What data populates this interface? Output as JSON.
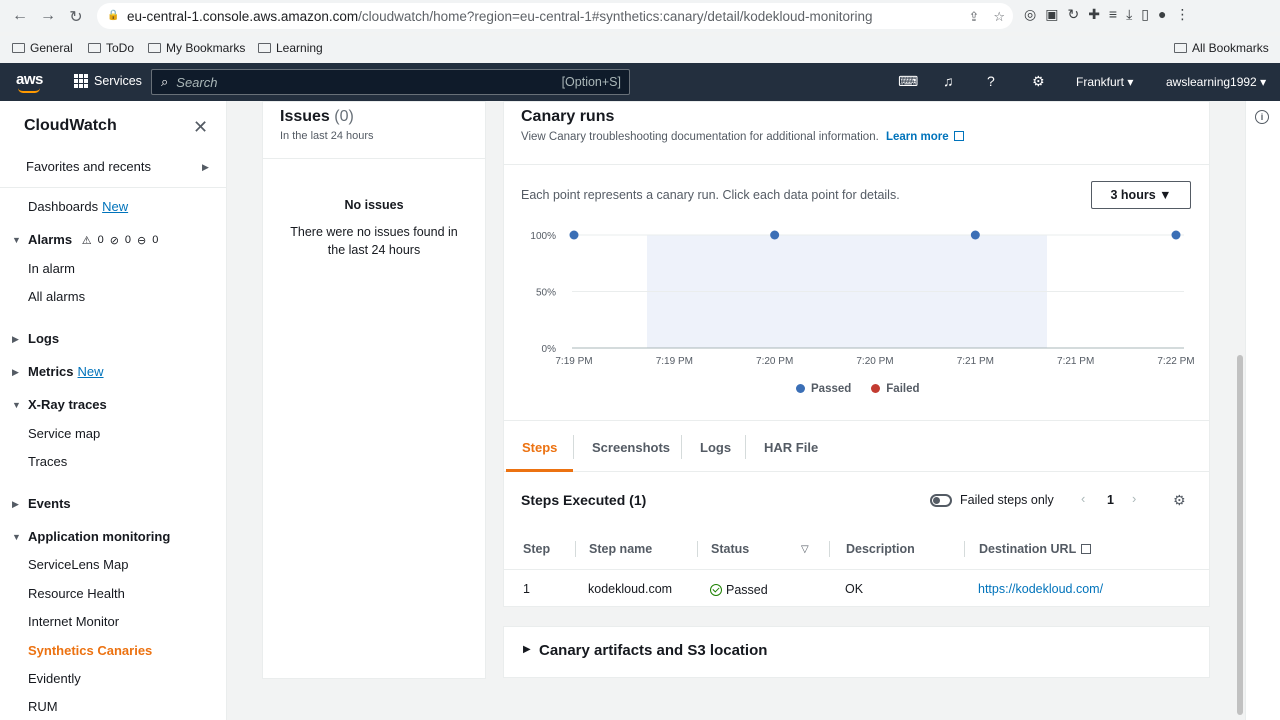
{
  "browser": {
    "url_host": "eu-central-1.console.aws.amazon.com",
    "url_path": "/cloudwatch/home?region=eu-central-1#synthetics:canary/detail/kodekloud-monitoring",
    "bookmarks": [
      "General",
      "ToDo",
      "My Bookmarks",
      "Learning"
    ],
    "all_bookmarks": "All Bookmarks"
  },
  "header": {
    "logo": "aws",
    "services": "Services",
    "search_placeholder": "Search",
    "search_shortcut": "[Option+S]",
    "region": "Frankfurt ▾",
    "account": "awslearning1992 ▾"
  },
  "sidebar": {
    "title": "CloudWatch",
    "favorites": "Favorites and recents",
    "dashboards": "Dashboards",
    "new_label": "New",
    "alarms": "Alarms",
    "alarm_counts": [
      "0",
      "0",
      "0"
    ],
    "in_alarm": "In alarm",
    "all_alarms": "All alarms",
    "logs": "Logs",
    "metrics": "Metrics",
    "xray": "X-Ray traces",
    "service_map": "Service map",
    "traces": "Traces",
    "events": "Events",
    "app_monitoring": "Application monitoring",
    "servicelens": "ServiceLens Map",
    "resource_health": "Resource Health",
    "internet_monitor": "Internet Monitor",
    "synthetics": "Synthetics Canaries",
    "evidently": "Evidently",
    "rum": "RUM"
  },
  "issues": {
    "title": "Issues",
    "count": "(0)",
    "subtitle": "In the last 24 hours",
    "empty_title": "No issues",
    "empty_desc": "There were no issues found in the last 24 hours"
  },
  "canary_runs": {
    "title": "Canary runs",
    "subtitle": "View Canary troubleshooting documentation for additional information.",
    "learn_more": "Learn more",
    "chart_desc": "Each point represents a canary run. Click each data point for details.",
    "time_range": "3 hours ▼",
    "legend_passed": "Passed",
    "legend_failed": "Failed"
  },
  "chart_data": {
    "type": "scatter",
    "y_ticks": [
      "100%",
      "50%",
      "0%"
    ],
    "x_ticks": [
      "7:19 PM",
      "7:19 PM",
      "7:20 PM",
      "7:20 PM",
      "7:21 PM",
      "7:21 PM",
      "7:22 PM"
    ],
    "ylim": [
      0,
      100
    ],
    "series": [
      {
        "name": "Passed",
        "color": "#3b6fb6",
        "points": [
          {
            "x": 0,
            "y": 100
          },
          {
            "x": 2,
            "y": 100
          },
          {
            "x": 4,
            "y": 100
          },
          {
            "x": 6,
            "y": 100
          }
        ]
      },
      {
        "name": "Failed",
        "color": "#c33b31",
        "points": []
      }
    ]
  },
  "tabs": [
    "Steps",
    "Screenshots",
    "Logs",
    "HAR File"
  ],
  "steps": {
    "title": "Steps Executed",
    "count": "(1)",
    "failed_only": "Failed steps only",
    "page": "1",
    "columns": [
      "Step",
      "Step name",
      "Status",
      "Description",
      "Destination URL"
    ],
    "rows": [
      {
        "step": "1",
        "name": "kodekloud.com",
        "status": "Passed",
        "description": "OK",
        "url": "https://kodekloud.com/"
      }
    ]
  },
  "artifacts": {
    "title": "Canary artifacts and S3 location"
  }
}
